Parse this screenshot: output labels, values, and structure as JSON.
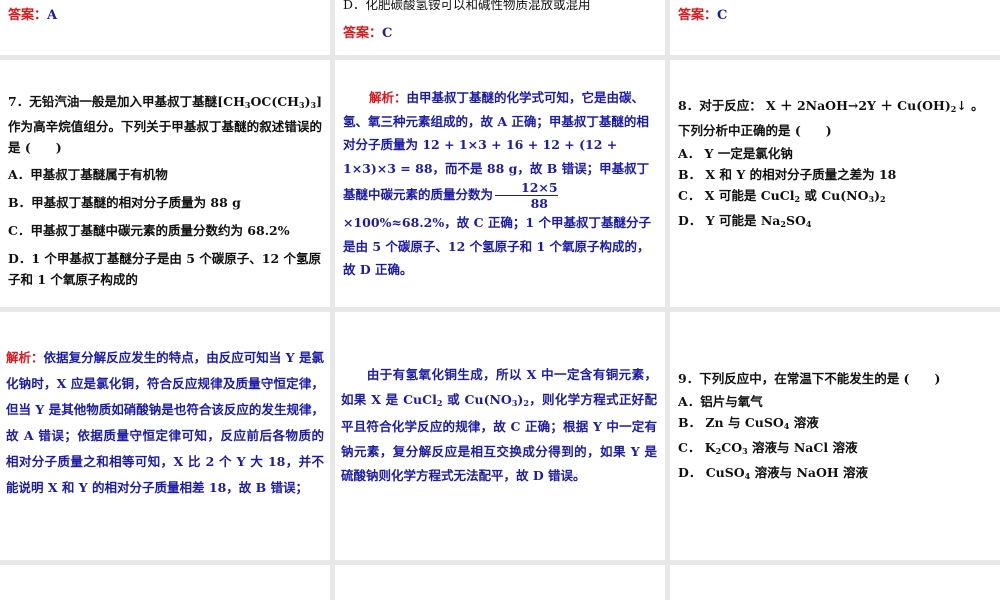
{
  "tiles": {
    "top_left": {
      "answer_label": "答案：",
      "answer_value": "A"
    },
    "top_middle": {
      "option_d": "D．化肥碳酸氢铵可以和碱性物质混放或混用",
      "answer_label": "答案：",
      "answer_value": "C"
    },
    "top_right": {
      "answer_label": "答案：",
      "answer_value": "C"
    },
    "q7": {
      "stem": [
        [
          "7．无铅汽油一般是加入甲基叔丁基醚"
        ],
        [
          "[CH",
          {
            "sub": "3"
          },
          "OC(CH",
          {
            "sub": "3"
          },
          ")",
          {
            "sub": "3"
          },
          "] 作为高辛烷值组分。下列关于甲基叔丁基醚的叙述错误的是 (　　)"
        ]
      ],
      "options": [
        "A．甲基叔丁基醚属于有机物",
        "B．甲基叔丁基醚的相对分子质量为 88 g",
        "C．甲基叔丁基醚中碳元素的质量分数约为 68.2%",
        "D．1 个甲基叔丁基醚分子是由 5 个碳原子、12 个氢原子和 1 个氧原子构成的"
      ]
    },
    "q7_analysis": {
      "label": "解析：",
      "text_1": "由甲基叔丁基醚的化学式可知，它是由碳、氢、氧三种元素组成的，故 A 正确；甲基叔丁基醚的相对分子质量为 12 + 1×3 + 16 + 12 + (12 + 1×3)×3 = 88，而不是 88 g，故 B 错误；甲基叔丁基醚中碳元素的质量分数为",
      "frac_num": "12×5",
      "frac_den": "88",
      "text_2": "×100%≈68.2%，故 C 正确；1 个甲基叔丁基醚分子是由 5 个碳原子、12 个氢原子和 1 个氧原子构成的，故 D 正确。"
    },
    "q8": {
      "stem": [
        [
          "8．对于反应： X ＋ 2NaOH→2Y ＋ Cu(OH)",
          {
            "sub": "2"
          },
          "↓ 。下列分析中正确的是 (　　)"
        ]
      ],
      "options": [
        [
          "A．  Y 一定是氯化钠"
        ],
        [
          "B．  X 和 Y 的相对分子质量之差为 18"
        ],
        [
          "C．  X 可能是 CuCl",
          {
            "sub": "2"
          },
          " 或 Cu(NO",
          {
            "sub": "3"
          },
          ")",
          {
            "sub": "2"
          }
        ],
        [
          "D．  Y 可能是 Na",
          {
            "sub": "2"
          },
          "SO",
          {
            "sub": "4"
          }
        ]
      ]
    },
    "q8_analysis_1": {
      "label": "解析：",
      "text": "依据复分解反应发生的特点，由反应可知当 Y 是氯化钠时，X 应是氯化铜，符合反应规律及质量守恒定律，但当 Y 是其他物质如硝酸钠是也符合该反应的发生规律，故 A 错误；依据质量守恒定律可知，反应前后各物质的相对分子质量之和相等可知，X 比 2 个 Y 大 18，并不能说明 X 和 Y 的相对分子质量相差 18，故 B 错误；"
    },
    "q8_analysis_2": {
      "text": [
        [
          "　　由于有氢氧化铜生成，所以 X 中一定含有铜元素，如果 X 是 CuCl",
          {
            "sub": "2"
          },
          " 或 Cu(NO",
          {
            "sub": "3"
          },
          ")",
          {
            "sub": "2"
          },
          "，则化学方程式正好配平且符合化学反应的规律，故 C 正确；根据 Y 中一定有钠元素，复分解反应是相互交换成分得到的，如果 Y 是硫酸钠则化学方程式无法配平，故 D 错误。"
        ]
      ]
    },
    "q9": {
      "stem": [
        [
          "9．下列反应中，在常温下不能发生的是 (　　)"
        ]
      ],
      "options": [
        [
          "A．铝片与氧气"
        ],
        [
          "B．  Zn 与 CuSO",
          {
            "sub": "4"
          },
          " 溶液"
        ],
        [
          "C．  K",
          {
            "sub": "2"
          },
          "CO",
          {
            "sub": "3"
          },
          " 溶液与 NaCl 溶液"
        ],
        [
          "D．  CuSO",
          {
            "sub": "4"
          },
          " 溶液与 NaOH 溶液"
        ]
      ]
    }
  }
}
